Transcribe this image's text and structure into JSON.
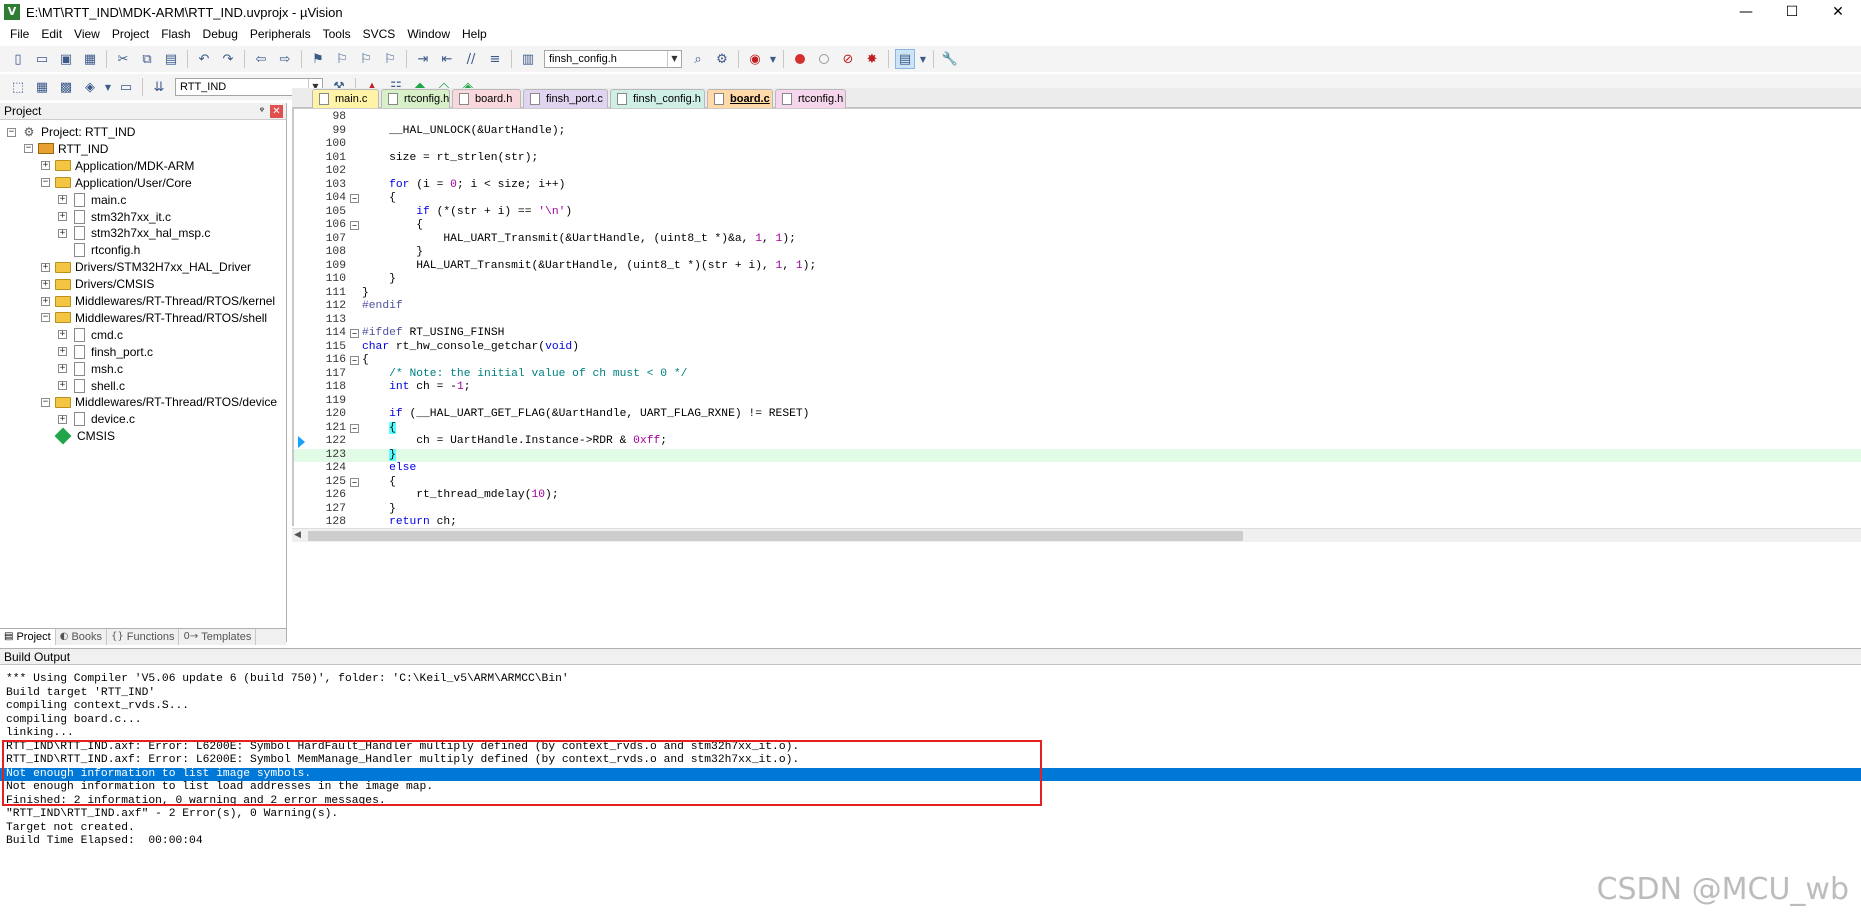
{
  "window": {
    "title": "E:\\MT\\RTT_IND\\MDK-ARM\\RTT_IND.uvprojx - µVision",
    "app_icon": "V",
    "minimize": "—",
    "maximize": "☐",
    "close": "✕"
  },
  "menu": [
    "File",
    "Edit",
    "View",
    "Project",
    "Flash",
    "Debug",
    "Peripherals",
    "Tools",
    "SVCS",
    "Window",
    "Help"
  ],
  "toolbar": {
    "file_combo": "finsh_config.h",
    "target_combo": "RTT_IND"
  },
  "project_panel": {
    "title": "Project",
    "pin": "ᵠ",
    "close": "✕",
    "tree": [
      {
        "label": "Project: RTT_IND",
        "depth": 0,
        "exp": "-",
        "icon": "proj"
      },
      {
        "label": "RTT_IND",
        "depth": 1,
        "exp": "-",
        "icon": "target"
      },
      {
        "label": "Application/MDK-ARM",
        "depth": 2,
        "exp": "+",
        "icon": "folder"
      },
      {
        "label": "Application/User/Core",
        "depth": 2,
        "exp": "-",
        "icon": "folder"
      },
      {
        "label": "main.c",
        "depth": 3,
        "exp": "+",
        "icon": "file"
      },
      {
        "label": "stm32h7xx_it.c",
        "depth": 3,
        "exp": "+",
        "icon": "file"
      },
      {
        "label": "stm32h7xx_hal_msp.c",
        "depth": 3,
        "exp": "+",
        "icon": "file"
      },
      {
        "label": "rtconfig.h",
        "depth": 3,
        "exp": "",
        "icon": "file"
      },
      {
        "label": "Drivers/STM32H7xx_HAL_Driver",
        "depth": 2,
        "exp": "+",
        "icon": "folder"
      },
      {
        "label": "Drivers/CMSIS",
        "depth": 2,
        "exp": "+",
        "icon": "folder"
      },
      {
        "label": "Middlewares/RT-Thread/RTOS/kernel",
        "depth": 2,
        "exp": "+",
        "icon": "folder"
      },
      {
        "label": "Middlewares/RT-Thread/RTOS/shell",
        "depth": 2,
        "exp": "-",
        "icon": "folder"
      },
      {
        "label": "cmd.c",
        "depth": 3,
        "exp": "+",
        "icon": "file"
      },
      {
        "label": "finsh_port.c",
        "depth": 3,
        "exp": "+",
        "icon": "file"
      },
      {
        "label": "msh.c",
        "depth": 3,
        "exp": "+",
        "icon": "file"
      },
      {
        "label": "shell.c",
        "depth": 3,
        "exp": "+",
        "icon": "file"
      },
      {
        "label": "Middlewares/RT-Thread/RTOS/device",
        "depth": 2,
        "exp": "-",
        "icon": "folder"
      },
      {
        "label": "device.c",
        "depth": 3,
        "exp": "+",
        "icon": "file"
      },
      {
        "label": "CMSIS",
        "depth": 2,
        "exp": "",
        "icon": "diamond"
      }
    ],
    "tabs": [
      {
        "label": "Project",
        "icon": "▤"
      },
      {
        "label": "Books",
        "icon": "◐"
      },
      {
        "label": "Functions",
        "icon": "{}"
      },
      {
        "label": "Templates",
        "icon": "0→"
      }
    ]
  },
  "editor": {
    "tabs": [
      {
        "label": "main.c",
        "color": "#fff3a8"
      },
      {
        "label": "rtconfig.h",
        "color": "#d8f0c8"
      },
      {
        "label": "board.h",
        "color": "#f8d8dc"
      },
      {
        "label": "finsh_port.c",
        "color": "#e0d4f0"
      },
      {
        "label": "finsh_config.h",
        "color": "#cfeee6"
      },
      {
        "label": "board.c",
        "color": "#ffd9a8"
      },
      {
        "label": "rtconfig.h",
        "color": "#f6d6ec"
      }
    ],
    "active_tab": 5,
    "lines": [
      {
        "n": "98",
        "f": "",
        "html": ""
      },
      {
        "n": "99",
        "f": "",
        "html": "    __HAL_UNLOCK(&UartHandle);"
      },
      {
        "n": "100",
        "f": "",
        "html": ""
      },
      {
        "n": "101",
        "f": "",
        "html": "    size = rt_strlen(str);"
      },
      {
        "n": "102",
        "f": "",
        "html": ""
      },
      {
        "n": "103",
        "f": "",
        "html": "    <span class=\"kw\">for</span> (i = <span class=\"num\">0</span>; i &lt; size; i++)"
      },
      {
        "n": "104",
        "f": "-",
        "html": "    {"
      },
      {
        "n": "105",
        "f": "",
        "html": "        <span class=\"kw\">if</span> (*(str + i) == <span class=\"str\">'\\n'</span>)"
      },
      {
        "n": "106",
        "f": "-",
        "html": "        {"
      },
      {
        "n": "107",
        "f": "",
        "html": "            HAL_UART_Transmit(&UartHandle, (uint8_t *)&a, <span class=\"num\">1</span>, <span class=\"num\">1</span>);"
      },
      {
        "n": "108",
        "f": "",
        "html": "        }"
      },
      {
        "n": "109",
        "f": "",
        "html": "        HAL_UART_Transmit(&UartHandle, (uint8_t *)(str + i), <span class=\"num\">1</span>, <span class=\"num\">1</span>);"
      },
      {
        "n": "110",
        "f": "",
        "html": "    }"
      },
      {
        "n": "111",
        "f": "",
        "html": "}"
      },
      {
        "n": "112",
        "f": "",
        "html": "<span class=\"pp\">#endif</span>"
      },
      {
        "n": "113",
        "f": "",
        "html": ""
      },
      {
        "n": "114",
        "f": "-",
        "html": "<span class=\"pp\">#ifdef</span> RT_USING_FINSH"
      },
      {
        "n": "115",
        "f": "",
        "html": "<span class=\"kw\">char</span> rt_hw_console_getchar(<span class=\"kw\">void</span>)"
      },
      {
        "n": "116",
        "f": "-",
        "html": "{"
      },
      {
        "n": "117",
        "f": "",
        "html": "    <span class=\"cmt\">/* Note: the initial value of ch must &lt; 0 */</span>"
      },
      {
        "n": "118",
        "f": "",
        "html": "    <span class=\"kw\">int</span> ch = -<span class=\"num\">1</span>;"
      },
      {
        "n": "119",
        "f": "",
        "html": ""
      },
      {
        "n": "120",
        "f": "",
        "html": "    <span class=\"kw\">if</span> (__HAL_UART_GET_FLAG(&UartHandle, UART_FLAG_RXNE) != RESET)"
      },
      {
        "n": "121",
        "f": "-",
        "html": "    <span class=\"brk\">{</span>"
      },
      {
        "n": "122",
        "f": "",
        "html": "        ch = UartHandle.Instance-&gt;RDR &amp; <span class=\"num\">0xff</span>;",
        "exec": true
      },
      {
        "n": "123",
        "f": "",
        "html": "    <span class=\"brk\">}</span>",
        "hl": true
      },
      {
        "n": "124",
        "f": "",
        "html": "    <span class=\"kw\">else</span>"
      },
      {
        "n": "125",
        "f": "-",
        "html": "    {"
      },
      {
        "n": "126",
        "f": "",
        "html": "        rt_thread_mdelay(<span class=\"num\">10</span>);"
      },
      {
        "n": "127",
        "f": "",
        "html": "    }"
      },
      {
        "n": "128",
        "f": "",
        "html": "    <span class=\"kw\">return</span> ch;"
      }
    ]
  },
  "build_output": {
    "title": "Build Output",
    "lines": [
      "*** Using Compiler 'V5.06 update 6 (build 750)', folder: 'C:\\Keil_v5\\ARM\\ARMCC\\Bin'",
      "Build target 'RTT_IND'",
      "compiling context_rvds.S...",
      "compiling board.c...",
      "linking...",
      "RTT_IND\\RTT_IND.axf: Error: L6200E: Symbol HardFault_Handler multiply defined (by context_rvds.o and stm32h7xx_it.o).",
      "RTT_IND\\RTT_IND.axf: Error: L6200E: Symbol MemManage_Handler multiply defined (by context_rvds.o and stm32h7xx_it.o).",
      "Not enough information to list image symbols.",
      "Not enough information to list load addresses in the image map.",
      "Finished: 2 information, 0 warning and 2 error messages.",
      "\"RTT_IND\\RTT_IND.axf\" - 2 Error(s), 0 Warning(s).",
      "Target not created.",
      "Build Time Elapsed:  00:00:04"
    ],
    "selected_line": 7
  },
  "watermark": "CSDN @MCU_wb"
}
